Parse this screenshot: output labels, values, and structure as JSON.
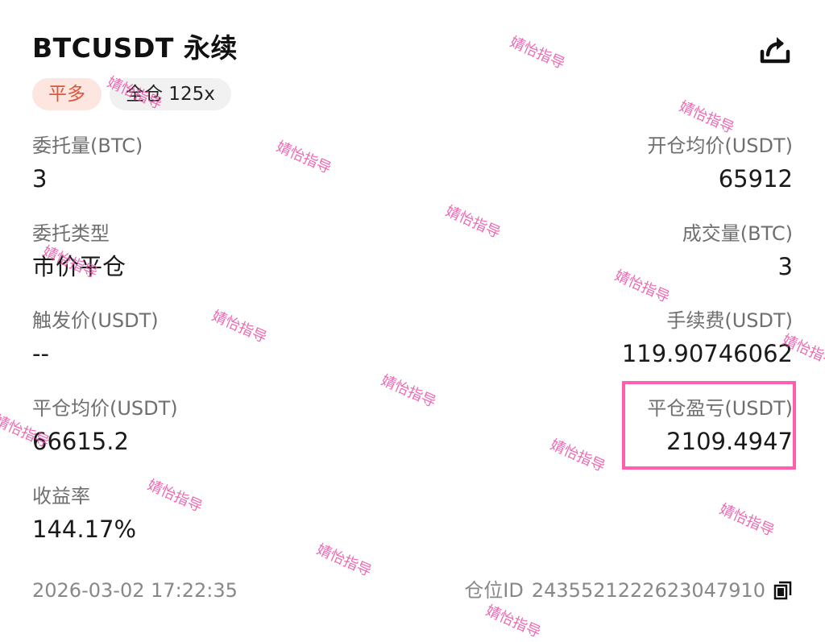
{
  "header": {
    "title": "BTCUSDT 永续",
    "side_badge": "平多",
    "margin_badge": "全仓 125x"
  },
  "fields": {
    "order_qty": {
      "label": "委托量(BTC)",
      "value": "3"
    },
    "open_avg_price": {
      "label": "开仓均价(USDT)",
      "value": "65912"
    },
    "order_type": {
      "label": "委托类型",
      "value": "市价平仓"
    },
    "filled_qty": {
      "label": "成交量(BTC)",
      "value": "3"
    },
    "trigger_price": {
      "label": "触发价(USDT)",
      "value": "--"
    },
    "fee": {
      "label": "手续费(USDT)",
      "value": "119.90746062"
    },
    "close_avg_price": {
      "label": "平仓均价(USDT)",
      "value": "66615.2"
    },
    "close_pnl": {
      "label": "平仓盈亏(USDT)",
      "value": "2109.4947"
    },
    "roi": {
      "label": "收益率",
      "value": "144.17%"
    }
  },
  "footer": {
    "timestamp": "2026-03-02 17:22:35",
    "position_id_label": "仓位ID",
    "position_id": "2435521222623047910"
  },
  "watermark_text": "婧怡指导",
  "colors": {
    "side_badge_bg": "#fde6df",
    "side_badge_text": "#e0553c",
    "highlight_border": "#ff5fae",
    "watermark": "#ec4fa7"
  },
  "icons": {
    "share": "share-icon",
    "copy": "copy-icon"
  }
}
